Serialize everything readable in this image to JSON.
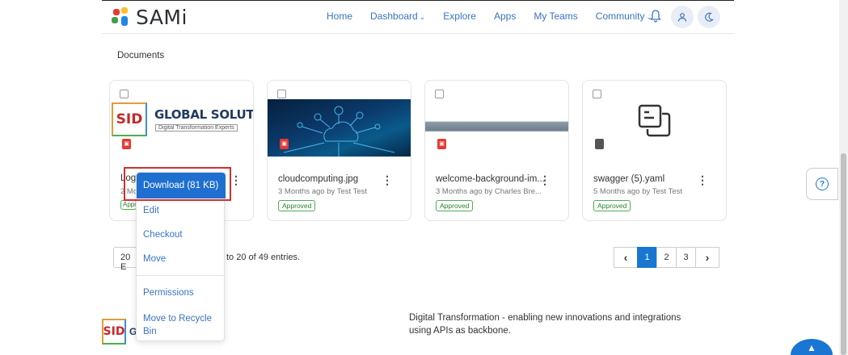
{
  "header": {
    "logo_text": "SAMi",
    "nav": [
      {
        "label": "Home",
        "dropdown": false
      },
      {
        "label": "Dashboard",
        "dropdown": true
      },
      {
        "label": "Explore",
        "dropdown": false
      },
      {
        "label": "Apps",
        "dropdown": false
      },
      {
        "label": "My Teams",
        "dropdown": false
      },
      {
        "label": "Community",
        "dropdown": true
      }
    ],
    "icons": [
      "bell-icon",
      "user-icon",
      "moon-icon"
    ]
  },
  "section_title": "Documents",
  "cards": [
    {
      "name": "Logo",
      "meta": "2 Mo",
      "status": "Approved",
      "file_icon": "image-file-icon",
      "logo_title": "GLOBAL SOLUTIONS",
      "logo_sub": "Digital Transformation Experts",
      "logo_mark": "SID"
    },
    {
      "name": "cloudcomputing.jpg",
      "meta": "3 Months ago by Test Test",
      "status": "Approved",
      "file_icon": "image-file-icon"
    },
    {
      "name": "welcome-background-im...",
      "meta": "3 Months ago by Charles Bre...",
      "status": "Approved",
      "file_icon": "image-file-icon"
    },
    {
      "name": "swagger (5).yaml",
      "meta": "5 Months ago by Test Test",
      "status": "Approved",
      "file_icon": "file-icon"
    }
  ],
  "menu": {
    "primary": "Download (81 KB)",
    "items": [
      "Edit",
      "Checkout",
      "Move",
      "Permissions",
      "Move to Recycle Bin"
    ]
  },
  "entries": {
    "select_value": "20 E",
    "text": "to 20 of 49 entries."
  },
  "pagination": {
    "prev": "‹",
    "pages": [
      "1",
      "2",
      "3"
    ],
    "active": "1",
    "next": "›"
  },
  "footer": {
    "logo_mark": "SID",
    "logo_partial": "G",
    "text": "Digital Transformation - enabling new innovations and integrations using APIs as backbone."
  },
  "help": "?",
  "colors": {
    "accent": "#1e6fd0",
    "approved": "#4caf50",
    "highlight": "#d32f2f"
  }
}
